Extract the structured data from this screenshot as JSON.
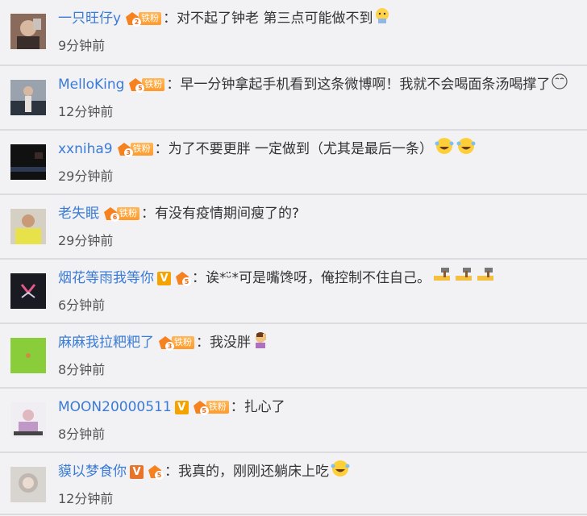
{
  "comments": [
    {
      "username": "一只旺仔y",
      "verified": "",
      "level": "2",
      "tag": "铁粉",
      "text": "对不起了钟老 第三点可能做不到",
      "emoji": "cry-emoji",
      "time": "9分钟前"
    },
    {
      "username": "MelloKing",
      "verified": "",
      "level": "5",
      "tag": "铁粉",
      "text": "早一分钟拿起手机看到这条微博啊！我就不会喝面条汤喝撑了",
      "emoji": "dizzy-emoji",
      "time": "12分钟前"
    },
    {
      "username": "xxniha9",
      "verified": "",
      "level": "3",
      "tag": "铁粉",
      "text": "为了不要更胖 一定做到（尤其是最后一条）",
      "emoji": "laugh-cry-emoji-x2",
      "time": "29分钟前"
    },
    {
      "username": "老失眠",
      "verified": "",
      "level": "6",
      "tag": "铁粉",
      "text": "有没有疫情期间瘦了的?",
      "emoji": "",
      "time": "29分钟前"
    },
    {
      "username": "烟花等雨我等你",
      "verified": "V",
      "level": "5",
      "tag": "",
      "text": "诶*ᵕ̈*可是嘴馋呀，俺控制不住自己。",
      "emoji": "hammer-emoji-x3",
      "time": "6分钟前"
    },
    {
      "username": "麻麻我拉粑粑了",
      "verified": "",
      "level": "3",
      "tag": "铁粉",
      "text": "我没胖",
      "emoji": "facepalm-emoji",
      "time": "8分钟前"
    },
    {
      "username": "MOON20000511",
      "verified": "V",
      "level": "5",
      "tag": "铁粉",
      "text": "扎心了",
      "emoji": "",
      "time": "8分钟前"
    },
    {
      "username": "貘以梦食你",
      "verified": "V",
      "level": "5",
      "tag": "",
      "text": "我真的，刚刚还躺床上吃",
      "emoji": "laugh-cry-emoji",
      "time": "12分钟前"
    }
  ],
  "colors": {
    "username": "#3a7bd5",
    "text": "#333333",
    "time": "#555555",
    "badge": "#ff9a2a",
    "verified_gold": "#f5a300",
    "verified_orange": "#e8742c"
  }
}
